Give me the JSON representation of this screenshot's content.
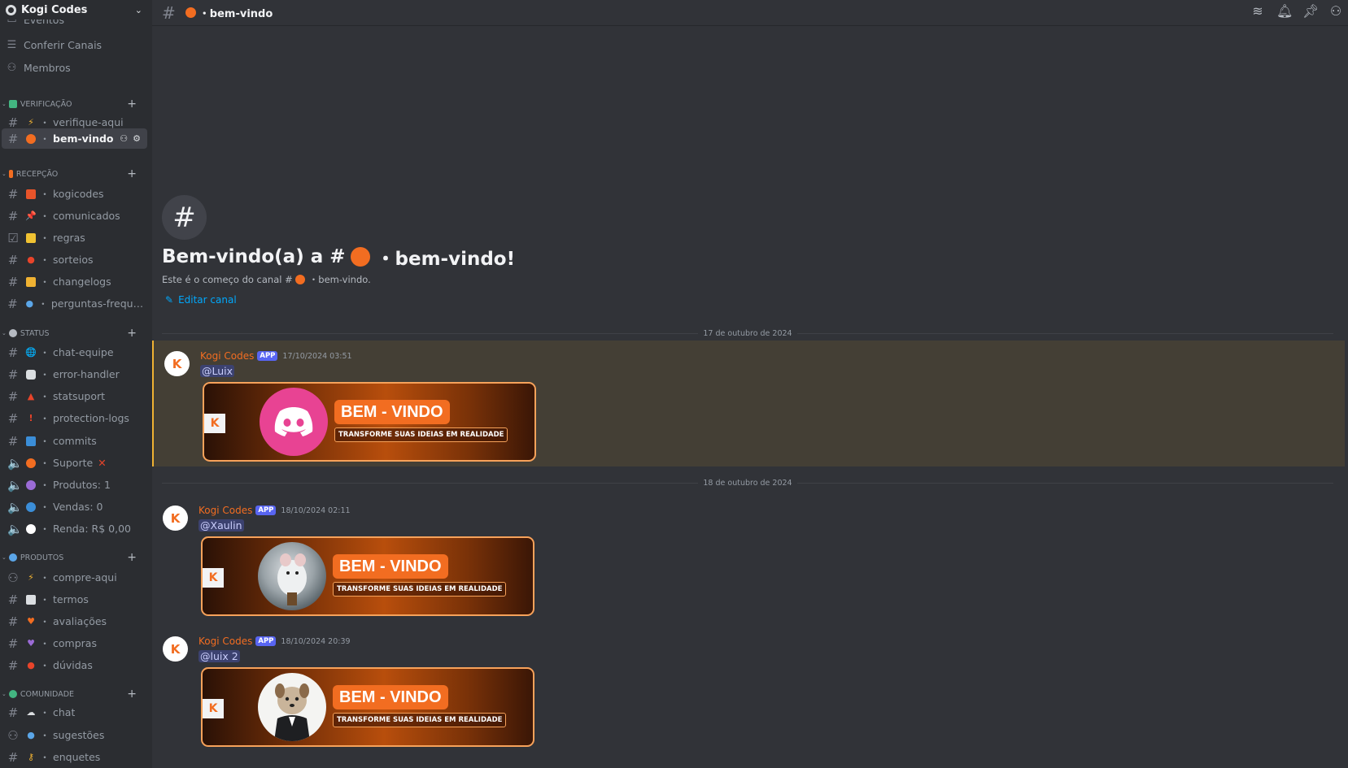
{
  "server": {
    "name": "Kogi Codes"
  },
  "sidebar": {
    "top_items": [
      {
        "label": "Eventos",
        "icon": "calendar-icon"
      },
      {
        "label": "Conferir Canais",
        "icon": "browse-channels-icon"
      },
      {
        "label": "Membros",
        "icon": "members-icon"
      }
    ],
    "categories": {
      "verificacao": "VERIFICAÇÃO",
      "recepcao": "RECEPÇÃO",
      "status": "STATUS",
      "produtos": "PRODUTOS",
      "comunidade": "COMUNIDADE"
    },
    "channels": {
      "verifique_aqui": "verifique-aqui",
      "bem_vindo": "bem-vindo",
      "kogicodes": "kogicodes",
      "comunicados": "comunicados",
      "regras": "regras",
      "sorteios": "sorteios",
      "changelogs": "changelogs",
      "perguntas": "perguntas-frequen...",
      "chat_equipe": "chat-equipe",
      "error_handler": "error-handler",
      "statsuport": "statsuport",
      "protection_logs": "protection-logs",
      "commits": "commits",
      "suporte": "Suporte",
      "produtos": "Produtos: 1",
      "vendas": "Vendas: 0",
      "renda": "Renda: R$ 0,00",
      "compre_aqui": "compre-aqui",
      "termos": "termos",
      "avaliacoes": "avaliações",
      "compras": "compras",
      "duvidas": "dúvidas",
      "chat": "chat",
      "sugestoes": "sugestões",
      "enquetes": "enquetes"
    }
  },
  "topbar": {
    "channel_name": "bem-vindo"
  },
  "welcome": {
    "title_prefix": "Bem-vindo(a) a #",
    "title_channel": "・bem-vindo!",
    "subtitle_prefix": "Este é o começo do canal #",
    "subtitle_channel": "・bem-vindo.",
    "edit_label": "Editar canal"
  },
  "dates": {
    "d1": "17 de outubro de 2024",
    "d2": "18 de outubro de 2024"
  },
  "messages": [
    {
      "author": "Kogi Codes",
      "badge": "APP",
      "time": "17/10/2024 03:51",
      "mention": "@Luix"
    },
    {
      "author": "Kogi Codes",
      "badge": "APP",
      "time": "18/10/2024 02:11",
      "mention": "@Xaulin"
    },
    {
      "author": "Kogi Codes",
      "badge": "APP",
      "time": "18/10/2024 20:39",
      "mention": "@luix 2"
    }
  ],
  "banner": {
    "title": "BEM - VINDO",
    "subtitle": "TRANSFORME SUAS IDEIAS EM REALIDADE"
  },
  "colors": {
    "accent": "#f26d21",
    "blurple": "#5865f2",
    "link": "#00a8fc"
  }
}
